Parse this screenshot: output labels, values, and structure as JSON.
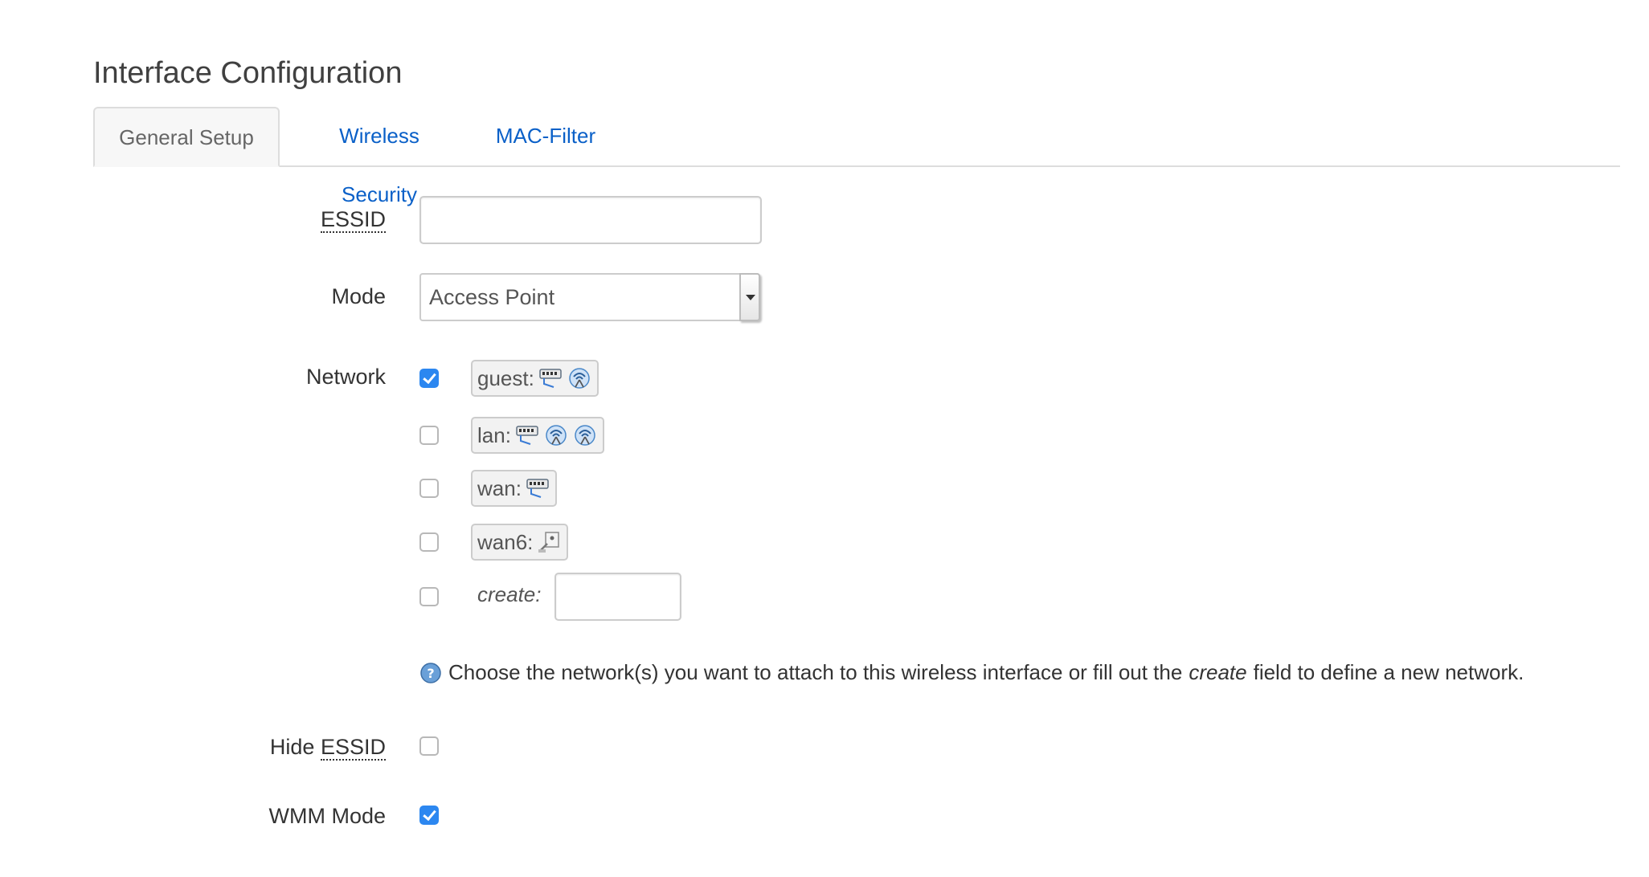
{
  "page": {
    "title": "Interface Configuration"
  },
  "tabs": [
    {
      "label": "General Setup",
      "active": true
    },
    {
      "label": "Wireless Security",
      "active": false
    },
    {
      "label": "MAC-Filter",
      "active": false
    }
  ],
  "form": {
    "essid": {
      "label": "ESSID",
      "value": ""
    },
    "mode": {
      "label": "Mode",
      "value": "Access Point"
    },
    "network": {
      "label": "Network",
      "options": [
        {
          "name": "guest:",
          "checked": true,
          "icons": [
            "ethernet-icon",
            "wifi-icon"
          ]
        },
        {
          "name": "lan:",
          "checked": false,
          "icons": [
            "ethernet-icon",
            "wifi-icon",
            "wifi-icon"
          ]
        },
        {
          "name": "wan:",
          "checked": false,
          "icons": [
            "ethernet-icon"
          ]
        },
        {
          "name": "wan6:",
          "checked": false,
          "icons": [
            "alias-icon"
          ]
        }
      ],
      "create": {
        "label": "create:",
        "checked": false,
        "value": ""
      },
      "help": {
        "before": "Choose the network(s) you want to attach to this wireless interface or fill out the",
        "emphasis": "create",
        "after": "field to define a new network."
      }
    },
    "hide_essid": {
      "label_prefix": "Hide",
      "label_abbr": "ESSID",
      "checked": false
    },
    "wmm_mode": {
      "label": "WMM Mode",
      "checked": true
    }
  },
  "colors": {
    "link": "#0a60c8",
    "checkbox_checked": "#2c87f0"
  }
}
